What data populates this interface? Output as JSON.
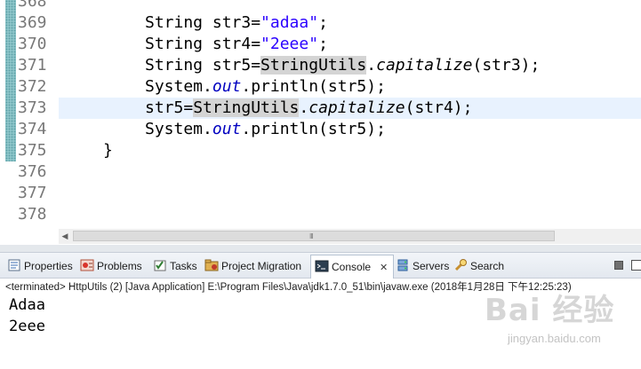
{
  "editor": {
    "lines": [
      {
        "num": "368",
        "segments": []
      },
      {
        "num": "369",
        "segments": [
          {
            "t": "String str3=",
            "c": "plain"
          },
          {
            "t": "\"adaa\"",
            "c": "str"
          },
          {
            "t": ";",
            "c": "plain"
          }
        ]
      },
      {
        "num": "370",
        "segments": [
          {
            "t": "String str4=",
            "c": "plain"
          },
          {
            "t": "\"2eee\"",
            "c": "str"
          },
          {
            "t": ";",
            "c": "plain"
          }
        ]
      },
      {
        "num": "371",
        "segments": [
          {
            "t": "String str5=",
            "c": "plain"
          },
          {
            "t": "StringUtils",
            "c": "occ"
          },
          {
            "t": ".",
            "c": "plain"
          },
          {
            "t": "capitalize",
            "c": "method-static"
          },
          {
            "t": "(str3);",
            "c": "plain"
          }
        ]
      },
      {
        "num": "372",
        "segments": [
          {
            "t": "System.",
            "c": "plain"
          },
          {
            "t": "out",
            "c": "field"
          },
          {
            "t": ".println(str5);",
            "c": "plain"
          }
        ]
      },
      {
        "num": "373",
        "segments": [
          {
            "t": "str5=",
            "c": "plain"
          },
          {
            "t": "StringUtils",
            "c": "occ"
          },
          {
            "t": ".",
            "c": "plain"
          },
          {
            "t": "capitalize",
            "c": "method-static"
          },
          {
            "t": "(str4);",
            "c": "plain"
          }
        ]
      },
      {
        "num": "374",
        "segments": [
          {
            "t": "System.",
            "c": "plain"
          },
          {
            "t": "out",
            "c": "field"
          },
          {
            "t": ".println(str5);",
            "c": "plain"
          }
        ]
      },
      {
        "num": "375",
        "segments": [
          {
            "t": "}",
            "c": "plain"
          }
        ]
      },
      {
        "num": "376",
        "segments": []
      },
      {
        "num": "377",
        "segments": []
      },
      {
        "num": "378",
        "segments": []
      }
    ],
    "current_line": "373",
    "scroll_grip": "III"
  },
  "tabs": [
    {
      "label": "Properties",
      "icon": "properties-icon",
      "active": false
    },
    {
      "label": "Problems",
      "icon": "problems-icon",
      "active": false
    },
    {
      "label": "Tasks",
      "icon": "tasks-icon",
      "active": false
    },
    {
      "label": "Project Migration",
      "icon": "project-migration-icon",
      "active": false
    },
    {
      "label": "Console",
      "icon": "console-icon",
      "active": true,
      "close": "✕"
    },
    {
      "label": "Servers",
      "icon": "servers-icon",
      "active": false
    },
    {
      "label": "Search",
      "icon": "search-icon",
      "active": false
    }
  ],
  "console": {
    "header": "<terminated> HttpUtils (2) [Java Application] E:\\Program Files\\Java\\jdk1.7.0_51\\bin\\javaw.exe (2018年1月28日 下午12:25:23)",
    "output": [
      "Adaa",
      "2eee"
    ]
  },
  "watermark": {
    "logo": "Bai 经验",
    "sub": "jingyan.baidu.com"
  },
  "colors": {
    "string": "#2a00ff",
    "field": "#0000c0",
    "occurrence_highlight": "#d4d4d4",
    "current_line": "#e8f2fe",
    "change_ruler": "#8cc5c9"
  }
}
